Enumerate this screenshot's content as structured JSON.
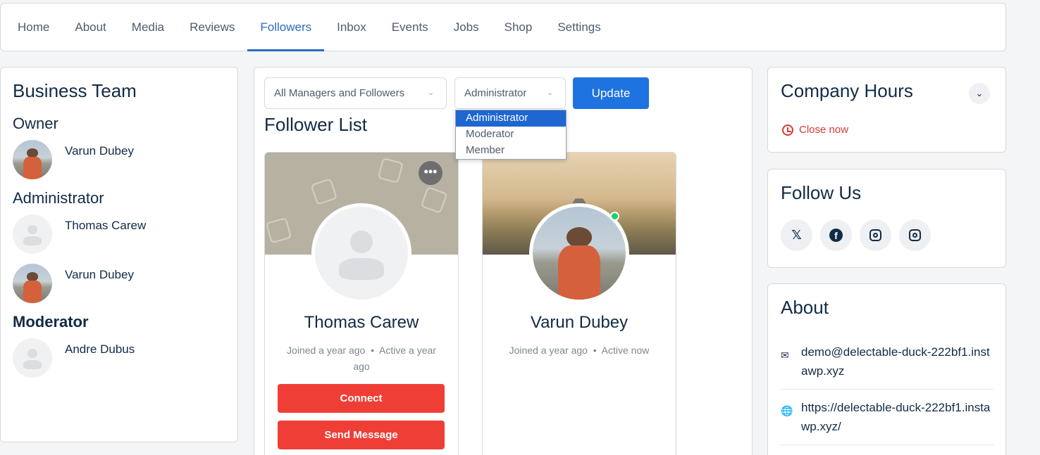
{
  "nav": {
    "items": [
      {
        "label": "Home"
      },
      {
        "label": "About"
      },
      {
        "label": "Media"
      },
      {
        "label": "Reviews"
      },
      {
        "label": "Followers",
        "active": true
      },
      {
        "label": "Inbox"
      },
      {
        "label": "Events"
      },
      {
        "label": "Jobs"
      },
      {
        "label": "Shop"
      },
      {
        "label": "Settings"
      }
    ]
  },
  "business_team": {
    "title": "Business Team",
    "owner_heading": "Owner",
    "owner": "Varun Dubey",
    "admin_heading": "Administrator",
    "admins": [
      "Thomas Carew",
      "Varun Dubey"
    ],
    "moderator_heading": "Moderator",
    "moderators": [
      "Andre Dubus"
    ]
  },
  "filters": {
    "scope_value": "All Managers and Followers",
    "role_value": "Administrator",
    "role_options": [
      "Administrator",
      "Moderator",
      "Member"
    ],
    "update_label": "Update"
  },
  "follower_list": {
    "title": "Follower List",
    "cards": [
      {
        "name": "Thomas Carew",
        "meta_joined": "Joined a year ago",
        "meta_active": "Active a year ago",
        "connect_label": "Connect",
        "message_label": "Send Message"
      },
      {
        "name": "Varun Dubey",
        "meta_joined": "Joined a year ago",
        "meta_active": "Active now"
      }
    ]
  },
  "company_hours": {
    "title": "Company Hours",
    "status": "Close now",
    "status_color": "#d33b35"
  },
  "follow_us": {
    "title": "Follow Us",
    "icons": [
      "x-icon",
      "facebook-icon",
      "instagram-icon",
      "instagram-icon"
    ]
  },
  "about": {
    "title": "About",
    "email": "demo@delectable-duck-222bf1.instawp.xyz",
    "website": "https://delectable-duck-222bf1.instawp.xyz/"
  },
  "colors": {
    "accent": "#2b6cc4",
    "update_button": "#1e73e0",
    "danger_button": "#ef3e36"
  }
}
